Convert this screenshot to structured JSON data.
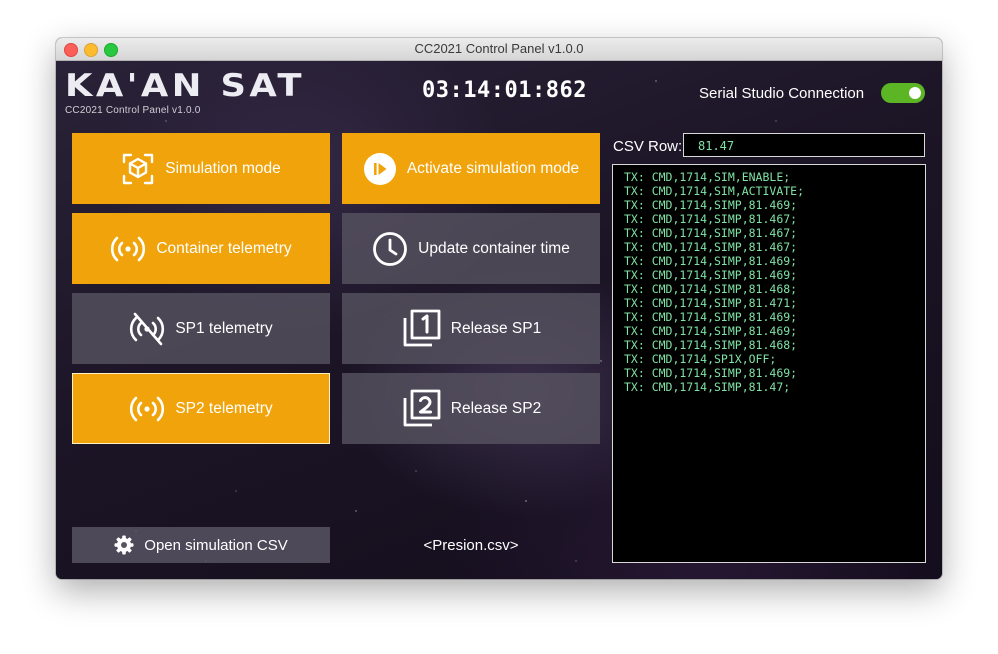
{
  "window": {
    "title": "CC2021 Control Panel v1.0.0"
  },
  "header": {
    "logo_text": "KA'AN SAT",
    "subtitle": "CC2021 Control Panel v1.0.0",
    "clock": "03:14:01:862",
    "serial_label": "Serial Studio Connection",
    "serial_connected": true
  },
  "buttons": {
    "simulation_mode": "Simulation mode",
    "activate_simulation": "Activate simulation mode",
    "container_telemetry": "Container telemetry",
    "update_container_time": "Update container time",
    "sp1_telemetry": "SP1 telemetry",
    "release_sp1": "Release SP1",
    "sp2_telemetry": "SP2 telemetry",
    "release_sp2": "Release SP2"
  },
  "csv": {
    "open_label": "Open simulation CSV",
    "file_name": "<Presion.csv>"
  },
  "csv_row": {
    "label": "CSV Row:",
    "value": "81.47"
  },
  "console": {
    "lines": [
      "TX: CMD,1714,SIM,ENABLE;",
      "TX: CMD,1714,SIM,ACTIVATE;",
      "TX: CMD,1714,SIMP,81.469;",
      "TX: CMD,1714,SIMP,81.467;",
      "TX: CMD,1714,SIMP,81.467;",
      "TX: CMD,1714,SIMP,81.467;",
      "TX: CMD,1714,SIMP,81.469;",
      "TX: CMD,1714,SIMP,81.469;",
      "TX: CMD,1714,SIMP,81.468;",
      "TX: CMD,1714,SIMP,81.471;",
      "TX: CMD,1714,SIMP,81.469;",
      "TX: CMD,1714,SIMP,81.469;",
      "TX: CMD,1714,SIMP,81.468;",
      "TX: CMD,1714,SP1X,OFF;",
      "TX: CMD,1714,SIMP,81.469;",
      "TX: CMD,1714,SIMP,81.47;"
    ]
  },
  "colors": {
    "accent_orange": "#f0a30a",
    "button_gray": "#585462",
    "console_text": "#7fe3a5",
    "toggle_on": "#5bb524"
  },
  "icons": {
    "simulation_mode": "cube-scan-icon",
    "activate_simulation": "play-circle-icon",
    "container_telemetry": "broadcast-icon",
    "update_container_time": "clock-icon",
    "sp1_telemetry": "broadcast-off-icon",
    "release_sp1": "filter-1-icon",
    "sp2_telemetry": "broadcast-icon",
    "release_sp2": "filter-2-icon",
    "open_csv": "gear-icon"
  }
}
